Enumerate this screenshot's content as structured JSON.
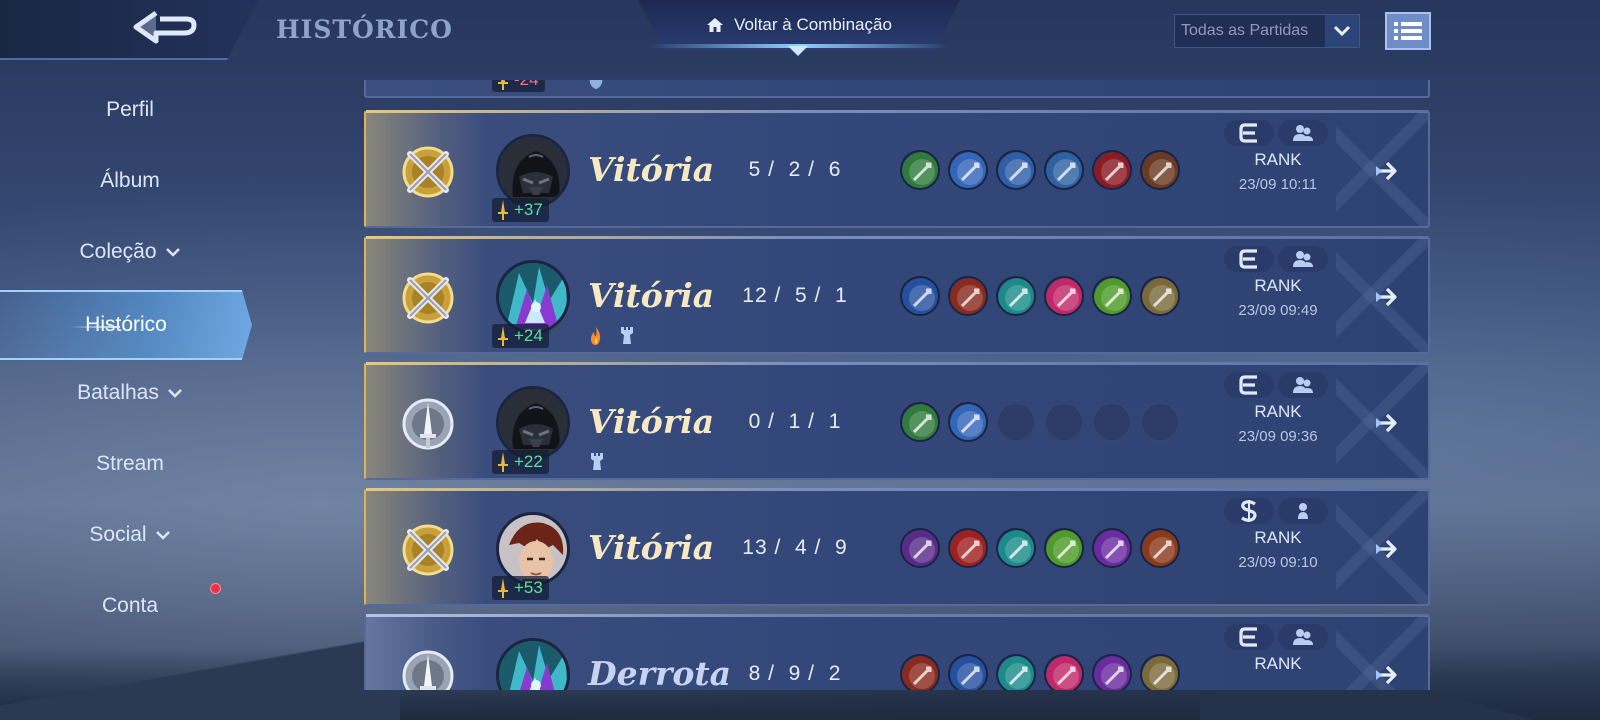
{
  "header": {
    "page_title": "HISTÓRICO",
    "return_button": "Voltar à Combinação",
    "filter_value": "Todas as Partidas"
  },
  "sidebar": {
    "items": [
      {
        "label": "Perfil",
        "has_chevron": false
      },
      {
        "label": "Álbum",
        "has_chevron": false
      },
      {
        "label": "Coleção",
        "has_chevron": true
      },
      {
        "label": "Histórico",
        "has_chevron": false,
        "active": true
      },
      {
        "label": "Batalhas",
        "has_chevron": true
      },
      {
        "label": "Stream",
        "has_chevron": false
      },
      {
        "label": "Social",
        "has_chevron": true
      },
      {
        "label": "Conta",
        "has_chevron": false,
        "notification": true
      }
    ]
  },
  "partial_top": {
    "points": "-24"
  },
  "matches": [
    {
      "result": "Vitória",
      "outcome": "win",
      "badge": "crossed-swords",
      "hero": "dark-helmet",
      "points": "+37",
      "kills": "5",
      "deaths": "2",
      "assists": "6",
      "items": [
        "#2f7a3c",
        "#3266b8",
        "#2f5ea8",
        "#2d62a0",
        "#8a1a24",
        "#6a3a22"
      ],
      "extra_badges": [],
      "mode_type": "team",
      "mode": "RANK",
      "date": "23/09 10:11"
    },
    {
      "result": "Vitória",
      "outcome": "win",
      "badge": "crossed-swords",
      "hero": "crystal-warrior",
      "points": "+24",
      "kills": "12",
      "deaths": "5",
      "assists": "1",
      "items": [
        "#2450a0",
        "#8a2a1e",
        "#1b8a8a",
        "#c0286a",
        "#4f9a2a",
        "#7a6a3a"
      ],
      "extra_badges": [
        "flame",
        "tower"
      ],
      "mode_type": "team",
      "mode": "RANK",
      "date": "23/09 09:49"
    },
    {
      "result": "Vitória",
      "outcome": "win",
      "badge": "single-sword",
      "hero": "dark-helmet",
      "points": "+22",
      "kills": "0",
      "deaths": "1",
      "assists": "1",
      "items": [
        "#2f7a3c",
        "#3266b8",
        "",
        "",
        "",
        ""
      ],
      "extra_badges": [
        "tower"
      ],
      "mode_type": "team",
      "mode": "RANK",
      "date": "23/09 09:36"
    },
    {
      "result": "Vitória",
      "outcome": "win",
      "badge": "crossed-swords",
      "hero": "red-haired-hero",
      "points": "+53",
      "kills": "13",
      "deaths": "4",
      "assists": "9",
      "items": [
        "#5a2a8a",
        "#a02020",
        "#1b8a8a",
        "#4f9a2a",
        "#6a2aa0",
        "#8a3a1a"
      ],
      "extra_badges": [],
      "mode_type": "solo",
      "mode": "RANK",
      "date": "23/09 09:10"
    },
    {
      "result": "Derrota",
      "outcome": "loss",
      "badge": "single-sword",
      "hero": "crystal-warrior",
      "points": "",
      "kills": "8",
      "deaths": "9",
      "assists": "2",
      "items": [
        "#8a2a1e",
        "#2450a0",
        "#1b8a8a",
        "#c0286a",
        "#6a2aa0",
        "#7a6a3a"
      ],
      "extra_badges": [],
      "mode_type": "team",
      "mode": "RANK",
      "date": ""
    }
  ]
}
